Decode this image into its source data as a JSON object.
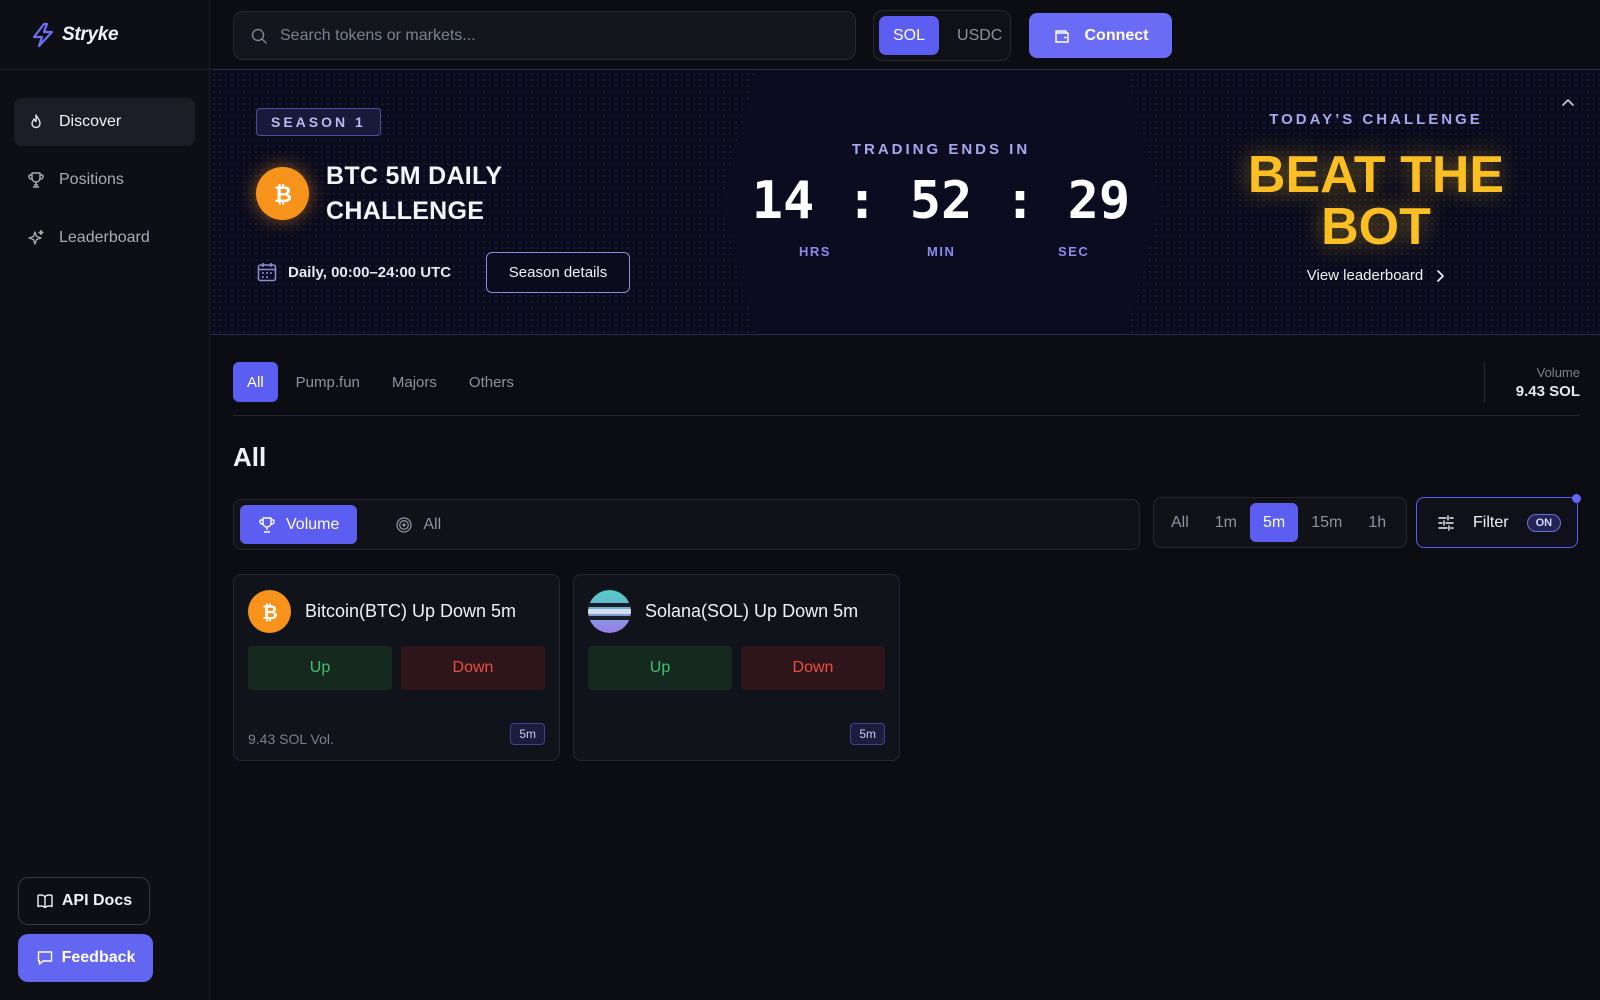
{
  "app": {
    "logo_text": "Stryke"
  },
  "sidebar": {
    "items": [
      {
        "label": "Discover",
        "icon": "flame-icon",
        "active": true
      },
      {
        "label": "Positions",
        "icon": "trophy-icon",
        "active": false
      },
      {
        "label": "Leaderboard",
        "icon": "sparkle-icon",
        "active": false
      }
    ],
    "api_docs_label": "API Docs",
    "feedback_label": "Feedback"
  },
  "topbar": {
    "search_placeholder": "Search tokens or markets...",
    "currencies": [
      "SOL",
      "USDC"
    ],
    "selected_currency": "SOL",
    "connect_label": "Connect"
  },
  "banner": {
    "season": "SEASON 1",
    "title": "BTC 5M DAILY CHALLENGE",
    "schedule": "Daily, 00:00–24:00 UTC",
    "season_details_label": "Season details",
    "ends_label": "TRADING ENDS IN",
    "hours": "14",
    "minutes": "52",
    "seconds": "29",
    "separator": ":",
    "hours_label": "HRS",
    "minutes_label": "MIN",
    "seconds_label": "SEC",
    "today_label": "TODAY’S CHALLENGE",
    "headline": "BEAT THE BOT",
    "view_leaderboard_label": "View leaderboard"
  },
  "main": {
    "tabs": [
      "All",
      "Pump.fun",
      "Majors",
      "Others"
    ],
    "active_tab": "All",
    "volume_label": "Volume",
    "volume_value": "9.43 SOL",
    "section_title": "All",
    "sort_options": [
      "Volume",
      "All"
    ],
    "active_sort": "Volume",
    "time_filters": [
      "All",
      "1m",
      "5m",
      "15m",
      "1h"
    ],
    "active_time": "5m",
    "filter_label": "Filter",
    "filter_state": "ON"
  },
  "markets": [
    {
      "title": "Bitcoin(BTC) Up Down 5m",
      "up_label": "Up",
      "down_label": "Down",
      "volume": "9.43 SOL Vol.",
      "interval": "5m",
      "icon": "bitcoin-icon"
    },
    {
      "title": "Solana(SOL) Up Down 5m",
      "up_label": "Up",
      "down_label": "Down",
      "volume": "",
      "interval": "5m",
      "icon": "solana-icon"
    }
  ],
  "colors": {
    "accent": "#5b5ef0",
    "gold": "#fbbf24",
    "bitcoin": "#f7931a",
    "up": "#3fbf6f",
    "down": "#ea4f43"
  }
}
